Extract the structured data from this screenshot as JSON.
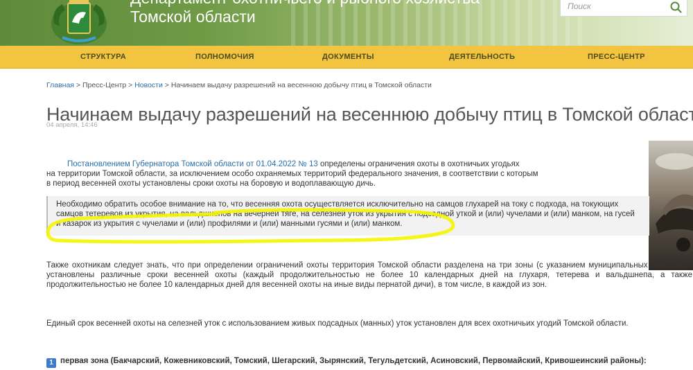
{
  "header": {
    "dept_title_line1": "Департамент охотничьего и рыбного хозяйства",
    "dept_title_line2": "Томской области",
    "emblem_icon": "tomsk-coat-of-arms-icon",
    "search": {
      "placeholder": "Поиск",
      "icon": "search-icon"
    }
  },
  "nav": {
    "items": [
      {
        "label": "СТРУКТУРА"
      },
      {
        "label": "ПОЛНОМОЧИЯ"
      },
      {
        "label": "ДОКУМЕНТЫ"
      },
      {
        "label": "ДЕЯТЕЛЬНОСТЬ"
      },
      {
        "label": "ПРЕСС-ЦЕНТР"
      }
    ]
  },
  "breadcrumb": {
    "home": "Главная",
    "sep": " > ",
    "press": "Пресс-Центр",
    "news": "Новости",
    "current": "Начинаем выдачу разрешений на весеннюю добычу птиц в Томской области"
  },
  "article": {
    "title": "Начинаем выдачу разрешений на весеннюю добычу птиц в Томской области",
    "date": "04 апреля, 14:46",
    "p1_link": "Постановлением Губернатора Томской области от 01.04.2022 № 13",
    "p1_rest_line1": " определены ограничения охоты в охотничьих угодьях",
    "p1_line2": "на территории Томской области, за исключением особо охраняемых территорий федерального значения,  в соответствии с которым",
    "p1_line3": "в период весенней охоты установлены сроки охоты на боровую и водоплавающую дичь.",
    "quote": "Необходимо обратить особое внимание на то, что весенняя охота осуществляется исключительно на самцов глухарей на току с подхода, на токующих самцов тетеревов из укрытия, на вальдшнепов на вечерней тяге, на селезней уток из укрытия с подсадной уткой и (или) чучелами и (или) манком, на гусей и казарок из укрытия с чучелами и (или) профилями и (или) манными гусями и (или) манком.",
    "p2": "Также охотникам следует знать, что при определении ограничений охоты территория Томской области разделена на три зоны (с указанием муниципальных районов) и установлены различные сроки весенней охоты (каждый продолжительностью не более 10 календарных дней на глухаря, тетерева и вальдшнепа, а также продолжительностью не более 10 календарных дней для весенней охоты на иные виды пернатой дичи), в том числе, в каждой из зон.",
    "p3": "Единый срок весенней охоты на селезней уток с использованием живых подсадных (манных) уток установлен для всех охотничьих угодий Томской области.",
    "zone_badge": "1",
    "zone_text": "первая зона (Бакчарский, Кожевниковский, Томский, Шегарский, Зырянский, Тегульдетский, Асиновский, Первомайский, Кривошеинский районы):"
  },
  "colors": {
    "nav_bg": "#f3c440",
    "link": "#2b6ea8",
    "highlight_marker": "#f5f500"
  }
}
